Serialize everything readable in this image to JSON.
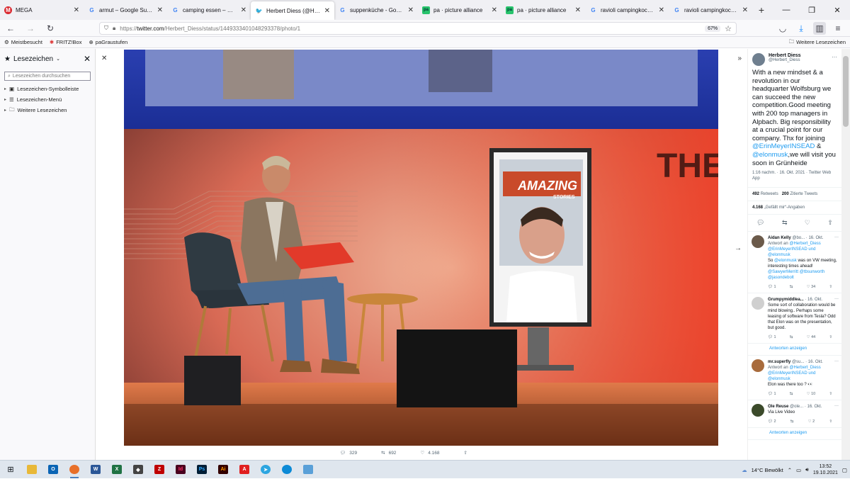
{
  "tabs": [
    {
      "label": "MEGA",
      "icon": "mega-icon",
      "fav": "mega",
      "glyph": "M",
      "active": false
    },
    {
      "label": "armut – Google Suche",
      "icon": "google-icon",
      "fav": "g",
      "glyph": "G",
      "active": false
    },
    {
      "label": "camping essen – Google",
      "icon": "google-icon",
      "fav": "g",
      "glyph": "G",
      "active": false
    },
    {
      "label": "Herbert Diess (@Herbert",
      "icon": "twitter-icon",
      "fav": "tw",
      "glyph": "🐦",
      "active": true
    },
    {
      "label": "suppenküche - Google S",
      "icon": "google-icon",
      "fav": "g",
      "glyph": "G",
      "active": false
    },
    {
      "label": "pa · picture alliance",
      "icon": "picture-alliance-icon",
      "fav": "pa",
      "glyph": "pa",
      "active": false
    },
    {
      "label": "pa · picture alliance",
      "icon": "picture-alliance-icon",
      "fav": "pa",
      "glyph": "pa",
      "active": false
    },
    {
      "label": "ravioli campingkocher -",
      "icon": "google-icon",
      "fav": "g",
      "glyph": "G",
      "active": false
    },
    {
      "label": "ravioli campingkocher -",
      "icon": "google-icon",
      "fav": "g",
      "glyph": "G",
      "active": false
    }
  ],
  "url": {
    "prefix": "https://",
    "domain": "twitter.com",
    "path": "/Herbert_Diess/status/1449333401048293378/photo/1",
    "zoom": "67%"
  },
  "bookmarks_bar": {
    "items": [
      "Meistbesucht",
      "FRITZ!Box",
      "paGraustufen"
    ],
    "other": "Weitere Lesezeichen"
  },
  "sidebar": {
    "title": "Lesezeichen",
    "search_placeholder": "Lesezeichen durchsuchen",
    "items": [
      "Lesezeichen-Symbolleiste",
      "Lesezeichen-Menü",
      "Weitere Lesezeichen"
    ]
  },
  "photo": {
    "poster_title": "AMAZING",
    "poster_sub": "STORIES",
    "wall_text": "THE"
  },
  "photo_actions": {
    "replies": "329",
    "retweets": "692",
    "likes": "4.168"
  },
  "tweet": {
    "name": "Herbert Diess",
    "handle": "@Herbert_Diess",
    "text_1": "With a new mindset & a revolution in our headquarter Wolfsburg we can succeed the new competition.Good meeting with 200 top managers in Alpbach. Big responsibility at a crucial point for our company. Thx for joining ",
    "mention_1": "@ErinMeyerINSEAD",
    "text_2": " & ",
    "mention_2": "@elonmusk",
    "text_3": ",we will visit you soon in Grünheide",
    "meta": "1:16 nachm. · 16. Okt. 2021 · Twitter Web App",
    "retweets": "492",
    "retweets_label": "Retweets",
    "quotes": "200",
    "quotes_label": "Zitierte Tweets",
    "likes": "4.168",
    "likes_label": "„Gefällt mir“-Angaben"
  },
  "replies": [
    {
      "name": "Aidan Kelly",
      "handle": "@bo...",
      "date": "· 16. Okt.",
      "reply_to_prefix": "Antwort an",
      "reply_to": "@Herbert_Diess @ErinMeyerINSEAD und @elonmusk",
      "pre": "So ",
      "mention": "@elonmusk",
      "text": " was on VW meeting, interesting times ahead!",
      "tags": "@SawyerMerritt @tbsunworth @jasondebolt",
      "c1": "1",
      "c2": "",
      "c3": "34",
      "av": "#6b5a4a"
    },
    {
      "name": "Grumpymiddlea...",
      "handle": "",
      "date": "· 16. Okt.",
      "reply_to_prefix": "",
      "reply_to": "",
      "pre": "",
      "mention": "",
      "text": "Some sort of collaboration would be mind blowing.. Perhaps some leasing of software from Tesla? Odd that Elon was on the presentation, but good.",
      "tags": "",
      "c1": "1",
      "c2": "",
      "c3": "44",
      "av": "#cfcfcf"
    },
    {
      "name": "mr.superfly",
      "handle": "@su...",
      "date": "· 16. Okt.",
      "reply_to_prefix": "Antwort an",
      "reply_to": "@Herbert_Diess @ErinMeyerINSEAD und @elonmusk",
      "pre": "",
      "mention": "",
      "text": "Elon was there too ? 👀",
      "tags": "",
      "c1": "1",
      "c2": "",
      "c3": "10",
      "av": "#a86b3c"
    },
    {
      "name": "Ole Reuse",
      "handle": "@ole...",
      "date": "· 16. Okt.",
      "reply_to_prefix": "",
      "reply_to": "",
      "pre": "",
      "mention": "",
      "text": "Via Live Video",
      "tags": "",
      "c1": "2",
      "c2": "",
      "c3": "2",
      "av": "#3b4a2a"
    }
  ],
  "show_replies": "Antworten anzeigen",
  "taskbar": {
    "weather": "14°C Bewölkt",
    "time": "13:52",
    "date": "19.10.2021"
  }
}
